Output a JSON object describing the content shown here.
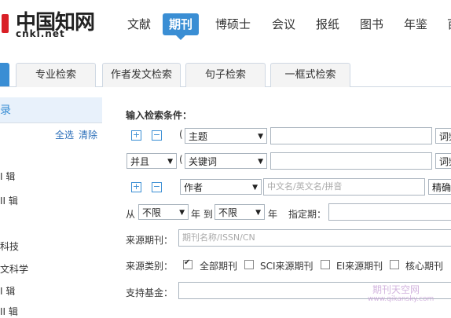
{
  "logo": {
    "title": "中国知网",
    "sub": "cnki.net"
  },
  "nav": [
    "文献",
    "期刊",
    "博硕士",
    "会议",
    "报纸",
    "图书",
    "年鉴",
    "百"
  ],
  "tabs": [
    "专业检索",
    "作者发文检索",
    "句子检索",
    "一框式检索"
  ],
  "left": {
    "head": "录",
    "select_all": "全选",
    "clear": "清除",
    "items": [
      "I 辑",
      "II 辑",
      "科技",
      "文科学",
      "I 辑",
      "II 辑"
    ]
  },
  "form": {
    "title": "输入检索条件：",
    "paren": "(",
    "row1": {
      "field": "主题",
      "freq": "词频"
    },
    "row2": {
      "logic": "并且",
      "field": "关键词",
      "freq": "词频"
    },
    "row3": {
      "field": "作者",
      "placeholder": "中文名/英文名/拼音",
      "match": "精确"
    },
    "year": {
      "from_label": "从",
      "from": "不限",
      "to_label": "年 到",
      "to": "不限",
      "end_label": "年",
      "specify": "指定期："
    },
    "source": {
      "label": "来源期刊：",
      "placeholder": "期刊名称/ISSN/CN"
    },
    "category": {
      "label": "来源类别：",
      "options": [
        "全部期刊",
        "SCI来源期刊",
        "EI来源期刊",
        "核心期刊"
      ],
      "checked": [
        true,
        false,
        false,
        false
      ]
    },
    "fund": {
      "label": "支持基金："
    }
  },
  "watermark": {
    "cn": "期刊天空网",
    "en": "www.qikansky.com"
  }
}
